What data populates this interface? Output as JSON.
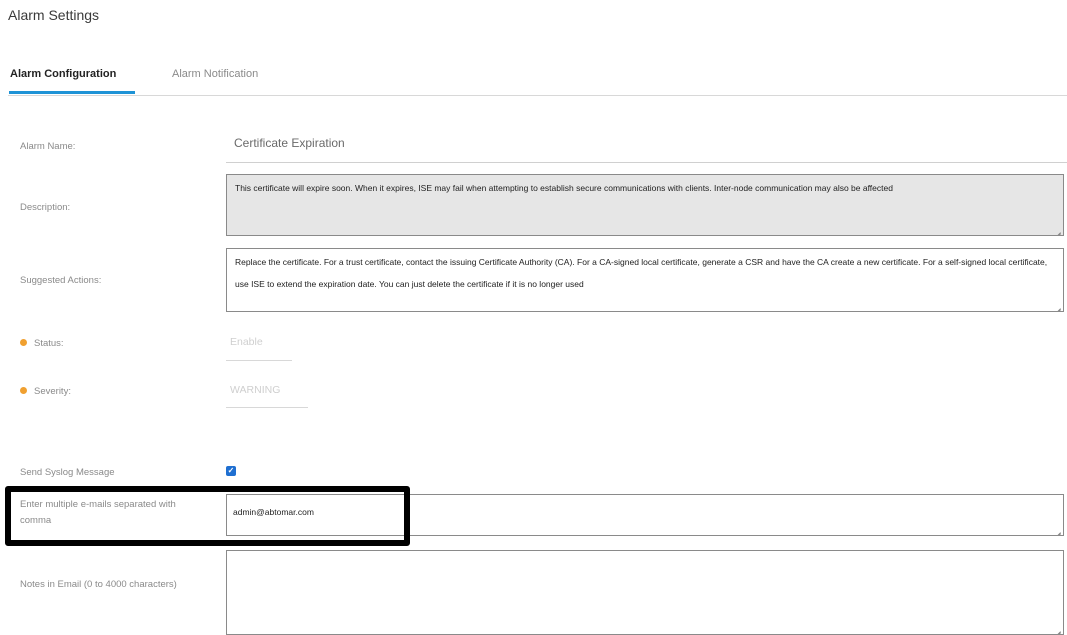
{
  "page": {
    "title": "Alarm Settings"
  },
  "tabs": [
    {
      "label": "Alarm Configuration",
      "active": true
    },
    {
      "label": "Alarm Notification",
      "active": false
    }
  ],
  "form": {
    "alarm_name": {
      "label": "Alarm Name:",
      "value": "Certificate Expiration"
    },
    "description": {
      "label": "Description:",
      "value": "This certificate will expire soon.  When it expires, ISE may fail when attempting to establish secure communications with clients.  Inter-node communication may also be affected"
    },
    "suggested_actions": {
      "label": "Suggested Actions:",
      "value": "Replace the certificate.  For a trust certificate, contact the issuing Certificate Authority (CA).  For a CA-signed local certificate, generate a CSR and have the CA create a new certificate.  For a self-signed local certificate, use ISE to extend the expiration date. You can just delete the certificate if it is no longer used"
    },
    "status": {
      "label": "Status:",
      "value": "Enable"
    },
    "severity": {
      "label": "Severity:",
      "value": "WARNING"
    },
    "send_syslog": {
      "label": "Send Syslog Message",
      "checked": true,
      "check_glyph": "✓"
    },
    "emails": {
      "label": "Enter multiple e-mails separated with comma",
      "value": "admin@abtomar.com"
    },
    "notes": {
      "label": "Notes in Email (0 to 4000 characters)",
      "value": ""
    }
  },
  "colors": {
    "tab_accent": "#1e93d6",
    "required_dot": "#f0a030",
    "checkbox": "#1f6fd1",
    "highlight_box": "#000000"
  }
}
